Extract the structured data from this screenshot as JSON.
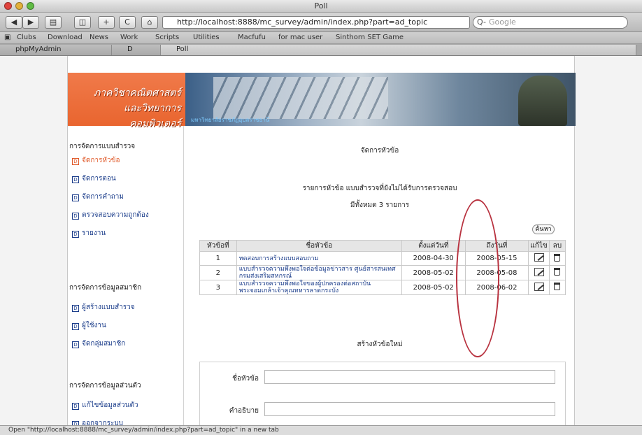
{
  "window": {
    "title": "Poll"
  },
  "toolbar": {
    "url": "http://localhost:8888/mc_survey/admin/index.php?part=ad_topic",
    "search_placeholder": "Google",
    "search_prefix": "Q-",
    "reload_label": "C"
  },
  "bookmarks": {
    "items": [
      "Clubs",
      "Download",
      "News",
      "Work",
      "Scripts",
      "Utilities",
      "Macfufu",
      "for mac user",
      "Sinthorn SET Game"
    ]
  },
  "tabs": [
    {
      "label": "phpMyAdmin"
    },
    {
      "label": "D"
    },
    {
      "label": "Poll"
    }
  ],
  "logo": {
    "line1": "ภาควิชาคณิตศาสตร์",
    "line2": "และวิทยาการคอมพิวเตอร์"
  },
  "banner": {
    "caption": "มหาวิทยาลัยราชภัฏอุบลราชธานี"
  },
  "nav": {
    "survey_section": "การจัดการแบบสำรวจ",
    "survey_items": [
      "จัดการหัวข้อ",
      "จัดการตอน",
      "จัดการคำถาม",
      "ตรวจสอบความถูกต้อง",
      "รายงาน"
    ],
    "member_section": "การจัดการข้อมูลสมาชิก",
    "member_items": [
      "ผู้สร้างแบบสำรวจ",
      "ผู้ใช้งาน",
      "จัดกลุ่มสมาชิก"
    ],
    "personal_section": "การจัดการข้อมูลส่วนตัว",
    "personal_items": [
      "แก้ไขข้อมูลส่วนตัว",
      "ออกจากระบบ"
    ]
  },
  "main": {
    "heading": "จัดการหัวข้อ",
    "list_caption": "รายการหัวข้อ แบบสำรวจที่ยังไม่ได้รับการตรวจสอบ",
    "total": "มีทั้งหมด 3 รายการ",
    "search_button": "ค้นหา",
    "columns": [
      "หัวข้อที่",
      "ชื่อหัวข้อ",
      "ตั้งแต่วันที่",
      "ถึงวันที่",
      "แก้ไข",
      "ลบ"
    ],
    "rows": [
      {
        "no": "1",
        "title": "ทดสอบการสร้างแบบสอบถาม",
        "start": "2008-04-30",
        "end": "2008-05-15"
      },
      {
        "no": "2",
        "title": "แบบสำรวจความพึงพอใจต่อข้อมูลข่าวสาร ศูนย์สารสนเทศ กรมส่งเสริมสหกรณ์",
        "start": "2008-05-02",
        "end": "2008-05-08"
      },
      {
        "no": "3",
        "title": "แบบสำรวจความพึงพอใจของผู้ปกครองต่อสถาบันพระจอมเกล้าเจ้าคุณทหารลาดกระบัง",
        "start": "2008-05-02",
        "end": "2008-06-02"
      }
    ],
    "new_heading": "สร้างหัวข้อใหม่",
    "form_topic_label": "ชื่อหัวข้อ",
    "form_desc_label": "คำอธิบาย"
  },
  "status": {
    "text": "Open \"http://localhost:8888/mc_survey/admin/index.php?part=ad_topic\" in a new tab"
  },
  "colors": {
    "accent": "#e9652f",
    "link": "#1a3c8a",
    "highlight_oval": "#b8323f"
  }
}
